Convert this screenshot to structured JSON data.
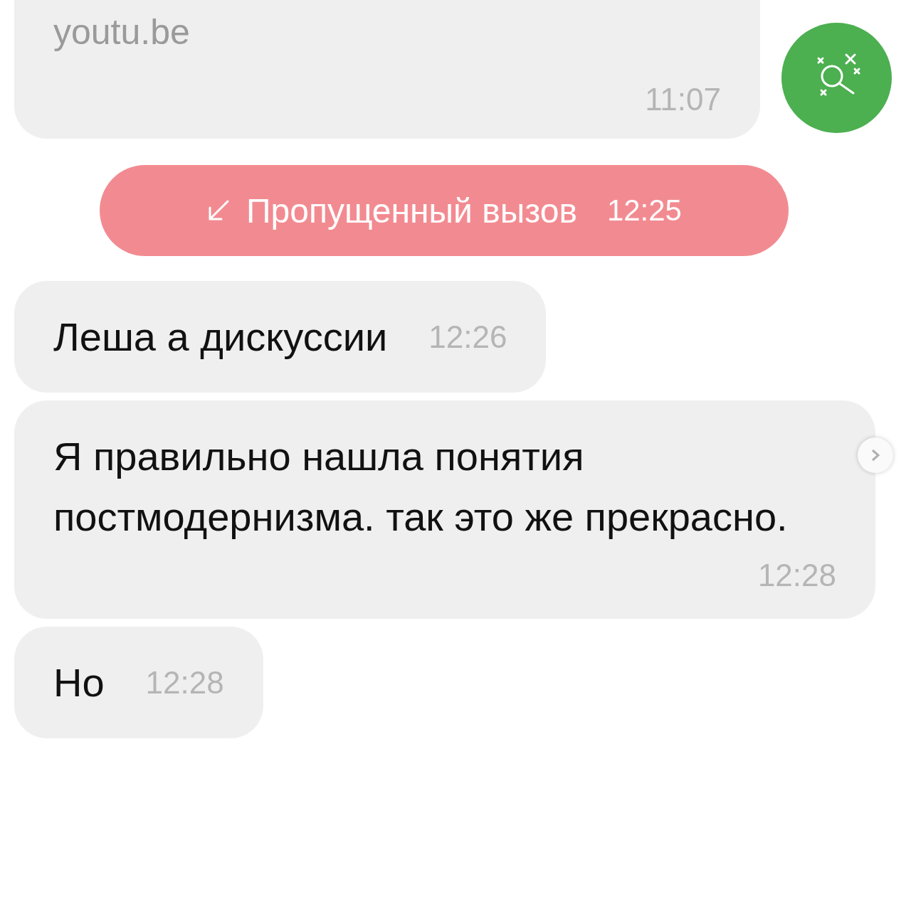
{
  "messages": [
    {
      "kind": "link",
      "text": "youtu.be",
      "time": "11:07"
    },
    {
      "kind": "missed_call",
      "text": "Пропущенный вызов",
      "time": "12:25"
    },
    {
      "kind": "text",
      "text": "Леша а дискуссии",
      "time": "12:26"
    },
    {
      "kind": "text",
      "text": "Я правильно нашла понятия постмодернизма. так это же прекрасно.",
      "time": "12:28"
    },
    {
      "kind": "text",
      "text": "Но",
      "time": "12:28"
    }
  ]
}
